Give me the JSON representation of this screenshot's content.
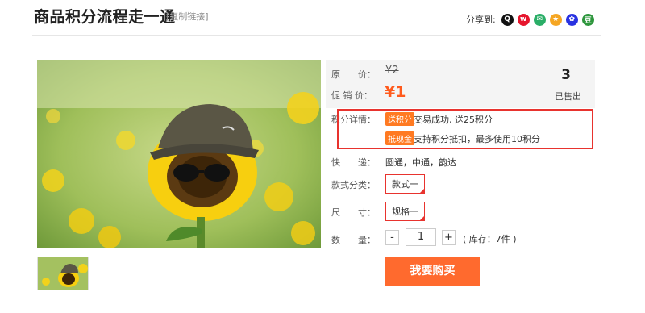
{
  "header": {
    "title": "商品积分流程走一通",
    "copy_link": "[复制链接]",
    "share_label": "分享到:"
  },
  "share_icons": [
    {
      "icon": "qq-icon",
      "color": "#111111",
      "glyph": "Q"
    },
    {
      "icon": "weibo-icon",
      "color": "#e6162d",
      "glyph": "w"
    },
    {
      "icon": "wechat-icon",
      "color": "#2aae67",
      "glyph": "✉"
    },
    {
      "icon": "qzone-icon",
      "color": "#f5a623",
      "glyph": "★"
    },
    {
      "icon": "baidu-icon",
      "color": "#2932e1",
      "glyph": "✿"
    },
    {
      "icon": "douban-icon",
      "color": "#2e963d",
      "glyph": "豆"
    }
  ],
  "product": {
    "orig_label": "原　　价：",
    "orig_price": "¥2",
    "promo_label": "促 销 价：",
    "promo_price": "¥1",
    "sold_count": "3",
    "sold_label": "已售出",
    "points_label": "积分详情：",
    "points": [
      {
        "tag": "送积分",
        "text": "交易成功, 送25积分"
      },
      {
        "tag": "抵现金",
        "text": "支持积分抵扣，最多使用10积分"
      }
    ],
    "express_label": "快　　递：",
    "express_value": "圆通，中通，韵达",
    "style_label": "款式分类：",
    "style_value": "款式一",
    "size_label": "尺　　寸：",
    "size_value": "规格一",
    "qty_label": "数　　量：",
    "qty_minus": "-",
    "qty_value": "1",
    "qty_plus": "+",
    "stock": "( 库存：7件 )",
    "buy_label": "我要购买"
  },
  "colors": {
    "accent": "#ff6a2e",
    "price": "#ff5a1c",
    "highlight_border": "#e8332e",
    "tag": "#ff7a22"
  }
}
